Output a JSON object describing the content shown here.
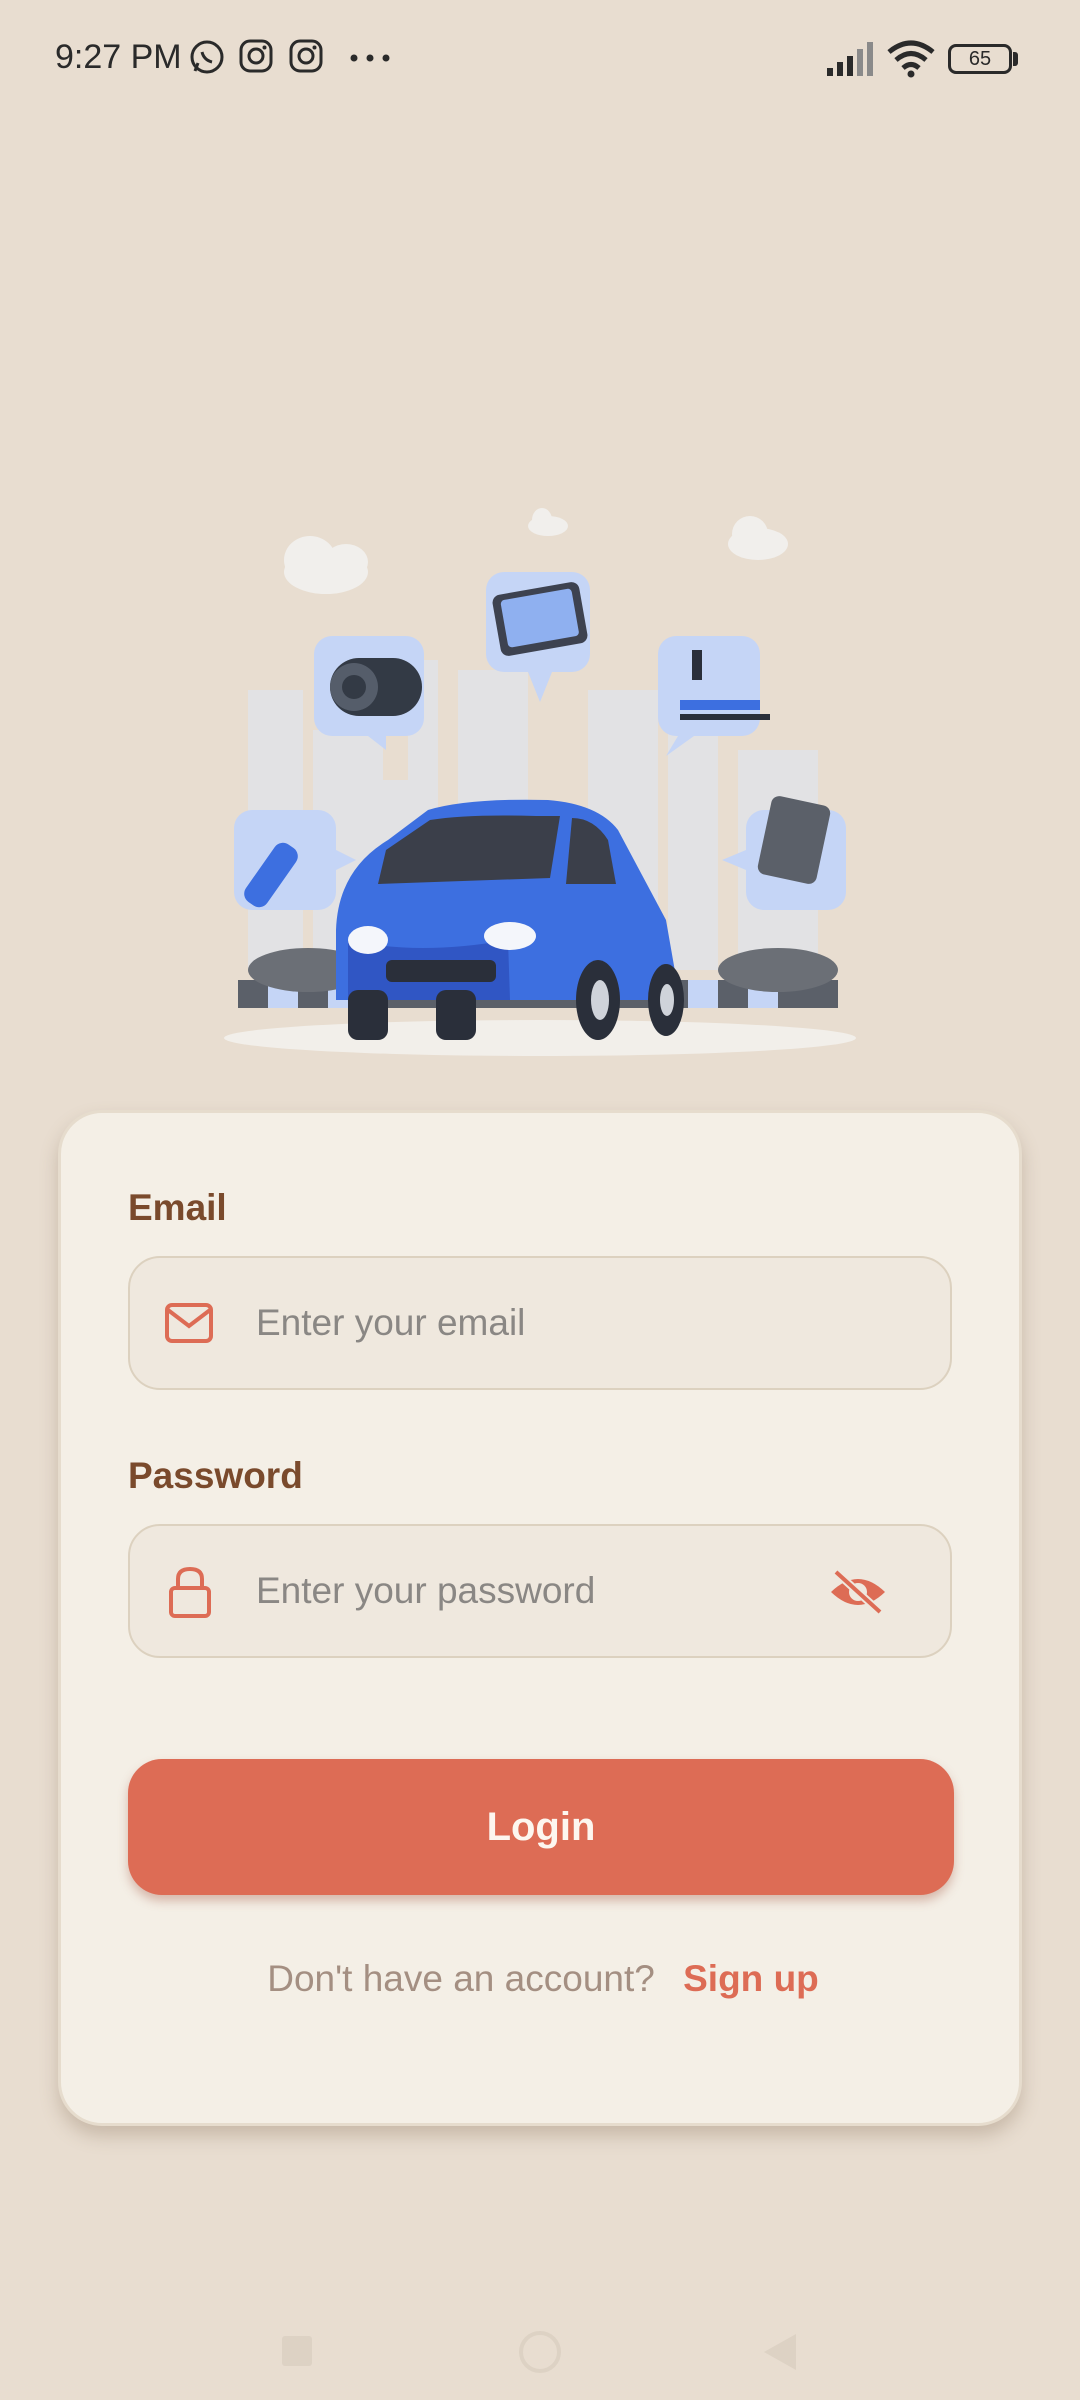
{
  "status_bar": {
    "time": "9:27 PM",
    "icons": [
      "whatsapp-icon",
      "instagram-icon",
      "instagram-icon",
      "more-dots-icon"
    ],
    "right_icons": [
      "signal-icon",
      "wifi-icon",
      "battery-icon"
    ],
    "battery": "65"
  },
  "hero": {
    "illustration": "car-service-illustration"
  },
  "form": {
    "email_label": "Email",
    "email_placeholder": "Enter your email",
    "email_value": "",
    "password_label": "Password",
    "password_placeholder": "Enter your password",
    "password_value": "",
    "login_label": "Login",
    "signup_prompt": "Don't have an account?",
    "signup_link": "Sign up"
  },
  "colors": {
    "background": "#e8ddd0",
    "card": "#f4efe6",
    "accent": "#dd6c55",
    "label": "#7a4a2c",
    "car_blue": "#3d6fe0"
  },
  "nav_bar": [
    "square-nav-icon",
    "circle-nav-icon",
    "back-triangle-icon"
  ]
}
